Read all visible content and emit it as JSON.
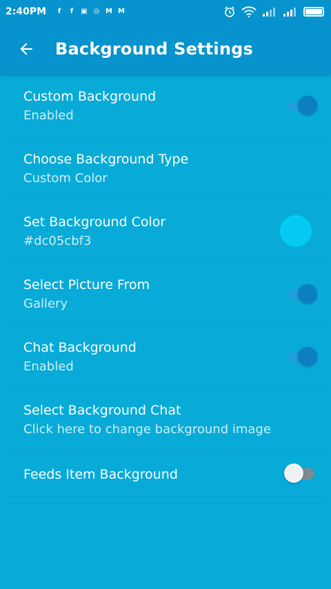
{
  "status_bar": {
    "time": "2:40PM",
    "notification_icons": [
      {
        "icon": "facebook-icon",
        "glyph": "f",
        "bg": "#0793cd"
      },
      {
        "icon": "facebook-icon",
        "glyph": "f",
        "bg": "#0793cd"
      },
      {
        "icon": "news-icon",
        "glyph": "▣",
        "bg": "#0793cd"
      },
      {
        "icon": "app-icon",
        "glyph": "◎",
        "bg": "#0793cd"
      },
      {
        "icon": "gmail-icon",
        "glyph": "M",
        "bg": "#0793cd"
      },
      {
        "icon": "gmail-icon",
        "glyph": "M",
        "bg": "#0793cd"
      }
    ],
    "right_icons": [
      "alarm-icon",
      "wifi-icon",
      "signal-icon",
      "signal-icon",
      "battery-icon"
    ]
  },
  "app_bar": {
    "title": "Background Settings",
    "back_icon": "arrow-left-icon"
  },
  "settings": [
    {
      "name": "custom-background",
      "title": "Custom Background",
      "summary": "Enabled",
      "control": "toggle",
      "on": true
    },
    {
      "name": "choose-background-type",
      "title": "Choose Background Type",
      "summary": "Custom Color",
      "control": "none"
    },
    {
      "name": "set-background-color",
      "title": "Set Background Color",
      "summary": "#dc05cbf3",
      "control": "color",
      "color": "#05cbf3"
    },
    {
      "name": "select-picture-from",
      "title": "Select Picture From",
      "summary": "Gallery",
      "control": "toggle",
      "on": true
    },
    {
      "name": "chat-background",
      "title": "Chat Background",
      "summary": "Enabled",
      "control": "toggle",
      "on": true
    },
    {
      "name": "select-background-chat",
      "title": "Select Background Chat",
      "summary": "Click here to change background image",
      "control": "none"
    },
    {
      "name": "feeds-item-background",
      "title": "Feeds Item Background",
      "summary": "",
      "control": "toggle",
      "on": false
    }
  ],
  "colors": {
    "app_bar": "#0793cd",
    "background": "#08abd7",
    "toggle_on": "#0c7fc2",
    "toggle_off_thumb": "#eef2f3"
  }
}
